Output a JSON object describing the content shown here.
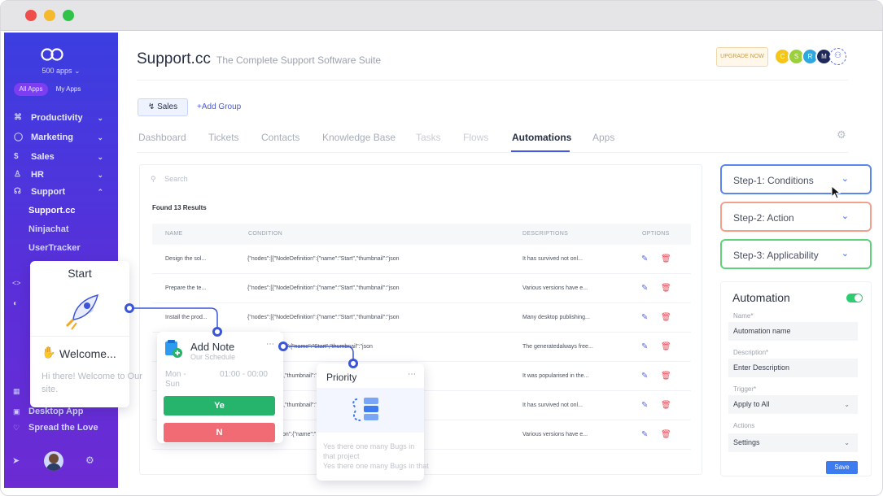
{
  "colors": {
    "accent": "#4657e6",
    "sidebar_start": "#3b3ee0",
    "sidebar_end": "#6c2bd3",
    "success": "#26b36b",
    "danger": "#f06b73",
    "step1_border": "#5b86f0",
    "step2_border": "#f2a08b",
    "step3_border": "#5fd17a"
  },
  "window": {
    "controls": [
      "close",
      "minimize",
      "maximize"
    ]
  },
  "sidebar": {
    "logo": "infinity-icon",
    "apps_count": "500 apps",
    "segments": [
      "All Apps",
      "My Apps"
    ],
    "nav": [
      {
        "label": "Productivity",
        "icon": "command-icon"
      },
      {
        "label": "Marketing",
        "icon": "target-icon"
      },
      {
        "label": "Sales",
        "icon": "dollar-icon"
      },
      {
        "label": "HR",
        "icon": "people-icon"
      },
      {
        "label": "Support",
        "icon": "headset-icon"
      }
    ],
    "support_sub": [
      "Support.cc",
      "Ninjachat",
      "UserTracker"
    ],
    "bottom": [
      "Desktop App",
      "Spread the Love"
    ]
  },
  "header": {
    "title": "Support.cc",
    "tagline": "The Complete Support Software Suite",
    "upgrade": "UPGRADE NOW",
    "avatars": [
      "C",
      "S",
      "R",
      "M"
    ]
  },
  "group": {
    "chip": "Sales",
    "add": "+Add Group"
  },
  "tabs": [
    "Dashboard",
    "Tickets",
    "Contacts",
    "Knowledge Base",
    "Tasks",
    "Flows",
    "Automations",
    "Apps"
  ],
  "list": {
    "search_placeholder": "Search",
    "found": "Found 13 Results",
    "columns": [
      "NAME",
      "CONDITION",
      "DESCRIPTIONS",
      "OPTIONS"
    ],
    "rows": [
      {
        "name": "Design the sol...",
        "condition": "{\"nodes\":[{\"NodeDefinition\":{\"name\":\"Start\",\"thumbnail\":\"json",
        "description": "It has survived not onl..."
      },
      {
        "name": "Prepare the te...",
        "condition": "{\"nodes\":[{\"NodeDefinition\":{\"name\":\"Start\",\"thumbnail\":\"json",
        "description": "Various versions have e..."
      },
      {
        "name": "Install the prod...",
        "condition": "{\"nodes\":[{\"NodeDefinition\":{\"name\":\"Start\",\"thumbnail\":\"json",
        "description": "Many desktop publishing..."
      },
      {
        "name": "",
        "condition": "\"NodeDefinition\":{\"name\":\"Start\",\"thumbnail\":\"json",
        "description": "The generatedalways free..."
      },
      {
        "name": "",
        "condition": "\"name\":\"Start\",\"thumbnail\":\"json",
        "description": "It was popularised in the..."
      },
      {
        "name": "",
        "condition": "\"name\":\"Start\",\"thumbnail\":\"json",
        "description": "It has survived not onl..."
      },
      {
        "name": "",
        "condition": "{\"NodeDefinition\":{\"name\":\"Start\",\"thumbnail\":\"json",
        "description": "Various versions have e..."
      }
    ]
  },
  "steps": [
    "Step-1: Conditions",
    "Step-2: Action",
    "Step-3: Applicability"
  ],
  "automation": {
    "title": "Automation",
    "enabled": true,
    "name_label": "Name*",
    "name_placeholder": "Automation name",
    "desc_label": "Description*",
    "desc_placeholder": "Enter Description",
    "trigger_label": "Trigger*",
    "trigger_value": "Apply to All",
    "actions_label": "Actions",
    "actions_value": "Settings",
    "save": "Save"
  },
  "flow": {
    "start": {
      "title": "Start",
      "welcome": "Welcome...",
      "message": "Hi there! Welcome to Our site."
    },
    "note": {
      "title": "Add Note",
      "subtitle": "Our Schedule",
      "days": "Mon - Sun",
      "hours": "01:00 - 00:00",
      "yes": "Ye",
      "no": "N"
    },
    "priority": {
      "title": "Priority",
      "text": "Yes there one many Bugs in that project",
      "text2": "Yes there one many Bugs in that"
    }
  }
}
